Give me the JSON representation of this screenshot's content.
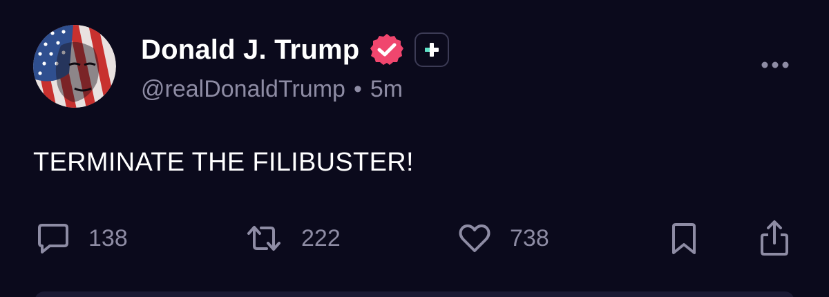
{
  "post": {
    "author": {
      "display_name": "Donald J. Trump",
      "handle": "@realDonaldTrump",
      "avatar_icon": "avatar-portrait-flag",
      "verified_icon": "verified-badge-icon",
      "verified_color": "#f0466e",
      "plus_icon": "plus-badge-icon",
      "plus_color": "#5fe3c8"
    },
    "separator": "•",
    "timestamp": "5m",
    "text": "TERMINATE THE FILIBUSTER!",
    "actions": {
      "replies": {
        "icon": "reply-icon",
        "count": "138"
      },
      "reposts": {
        "icon": "repost-icon",
        "count": "222"
      },
      "likes": {
        "icon": "heart-icon",
        "count": "738"
      },
      "bookmark": {
        "icon": "bookmark-icon"
      },
      "share": {
        "icon": "share-icon"
      }
    },
    "more_icon": "more-options-icon"
  },
  "colors": {
    "background": "#0b0a1c",
    "text_primary": "#ffffff",
    "text_secondary": "#8e8ca4"
  }
}
